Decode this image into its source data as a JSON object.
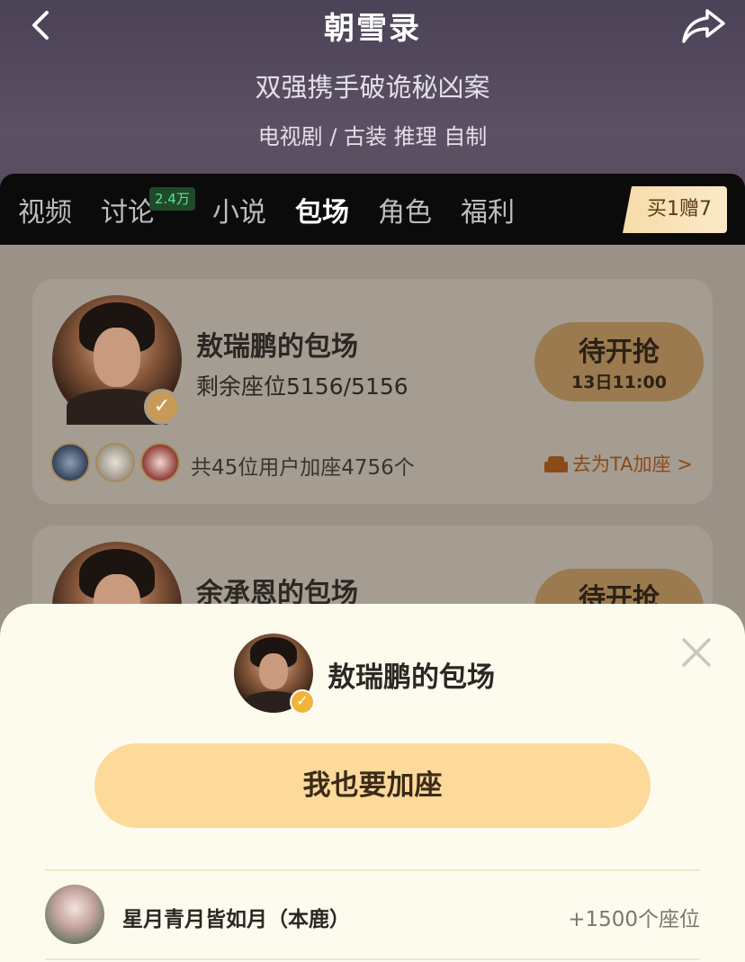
{
  "header": {
    "title": "朝雪录",
    "subtitle": "双强携手破诡秘凶案",
    "tags": "电视剧 / 古装  推理  自制"
  },
  "tabs": [
    {
      "label": "视频"
    },
    {
      "label": "讨论",
      "badge": "2.4万"
    },
    {
      "label": "小说"
    },
    {
      "label": "包场"
    },
    {
      "label": "角色"
    },
    {
      "label": "福利"
    }
  ],
  "promo": "买1赠7",
  "cards": [
    {
      "title": "敖瑞鹏的包场",
      "seats": "剩余座位5156/5156",
      "status": "待开抢",
      "time": "13日11:00",
      "join_count": "共45位用户加座4756个",
      "join_link": "去为TA加座 >"
    },
    {
      "title": "余承恩的包场",
      "status": "待开抢"
    }
  ],
  "sheet": {
    "title": "敖瑞鹏的包场",
    "cta": "我也要加座",
    "users": [
      {
        "name": "星月青月皆如月（本鹿）",
        "seats": "+1500个座位"
      }
    ]
  },
  "colors": {
    "accent": "#fdd99a",
    "badge_green": "#5fe08a",
    "verified": "#f0b43c"
  }
}
